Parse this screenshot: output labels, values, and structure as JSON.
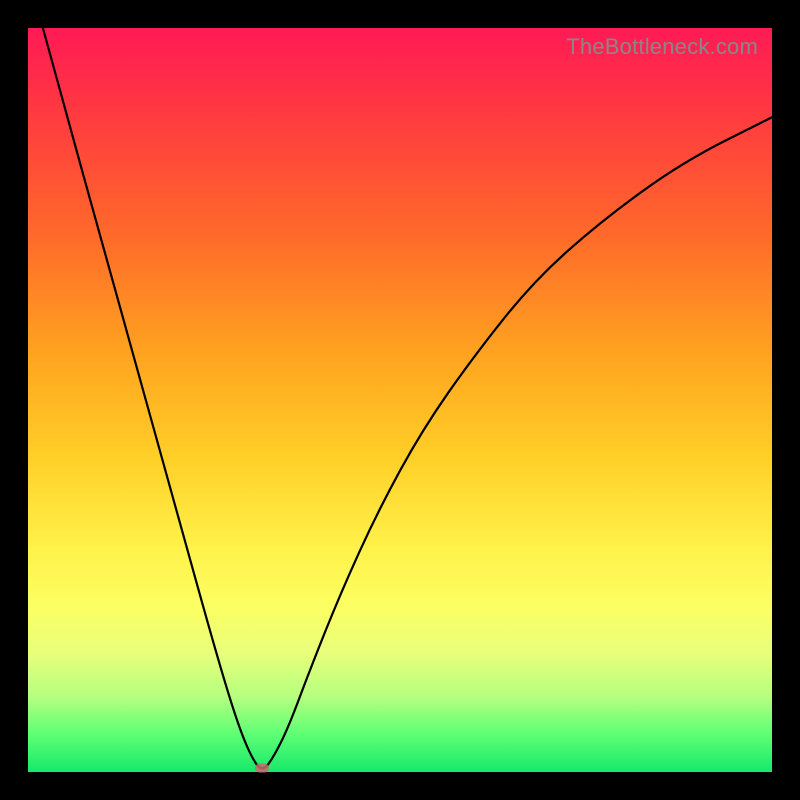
{
  "watermark": "TheBottleneck.com",
  "chart_data": {
    "type": "line",
    "title": "",
    "xlabel": "",
    "ylabel": "",
    "xlim": [
      0,
      100
    ],
    "ylim": [
      0,
      100
    ],
    "grid": false,
    "legend": false,
    "series": [
      {
        "name": "bottleneck-curve",
        "x": [
          2,
          5,
          10,
          15,
          20,
          25,
          28,
          30,
          31.5,
          33,
          35,
          38,
          42,
          47,
          53,
          60,
          68,
          77,
          88,
          100
        ],
        "values": [
          100,
          89,
          71,
          53,
          35,
          17,
          7,
          2,
          0,
          2,
          6,
          14,
          24,
          35,
          46,
          56,
          66,
          74,
          82,
          88
        ]
      }
    ],
    "marker": {
      "x": 31.5,
      "y": 0.5
    },
    "colors": {
      "curve": "#000000",
      "marker": "#c66b6b",
      "gradient_top": "#ff1a55",
      "gradient_bottom": "#17e86b"
    }
  }
}
